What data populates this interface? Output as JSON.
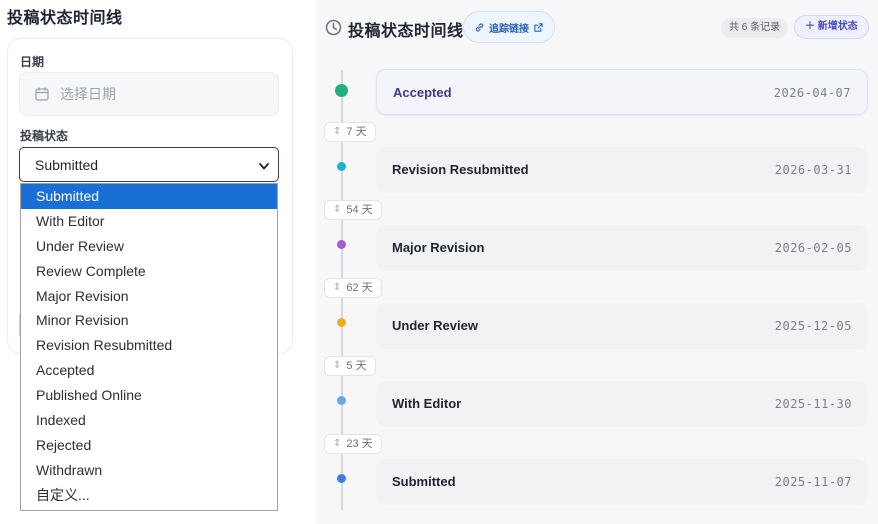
{
  "left": {
    "title": "投稿状态时间线",
    "date_label": "日期",
    "date_placeholder": "选择日期",
    "status_label": "投稿状态",
    "status_selected": "Submitted",
    "status_options": [
      "Submitted",
      "With Editor",
      "Under Review",
      "Review Complete",
      "Major Revision",
      "Minor Revision",
      "Revision Resubmitted",
      "Accepted",
      "Published Online",
      "Indexed",
      "Rejected",
      "Withdrawn",
      "自定义..."
    ]
  },
  "right": {
    "title": "投稿状态时间线",
    "track_link": "追踪链接",
    "count_badge": "共 6 条记录",
    "add_status": "＋ 新增状态",
    "events": [
      {
        "name": "Accepted",
        "date": "2026-04-07",
        "color": "#22b07d"
      },
      {
        "name": "Revision Resubmitted",
        "date": "2026-03-31",
        "color": "#17b3cf"
      },
      {
        "name": "Major Revision",
        "date": "2026-02-05",
        "color": "#a55ad8"
      },
      {
        "name": "Under Review",
        "date": "2025-12-05",
        "color": "#e7b01c"
      },
      {
        "name": "With Editor",
        "date": "2025-11-30",
        "color": "#6aa6ea"
      },
      {
        "name": "Submitted",
        "date": "2025-11-07",
        "color": "#3d7fe0"
      }
    ],
    "gaps": [
      "7 天",
      "54 天",
      "62 天",
      "5 天",
      "23 天"
    ]
  },
  "colors": {
    "accent": "#1a6fd6",
    "link": "#2a62b5",
    "add": "#4b4dc2"
  }
}
